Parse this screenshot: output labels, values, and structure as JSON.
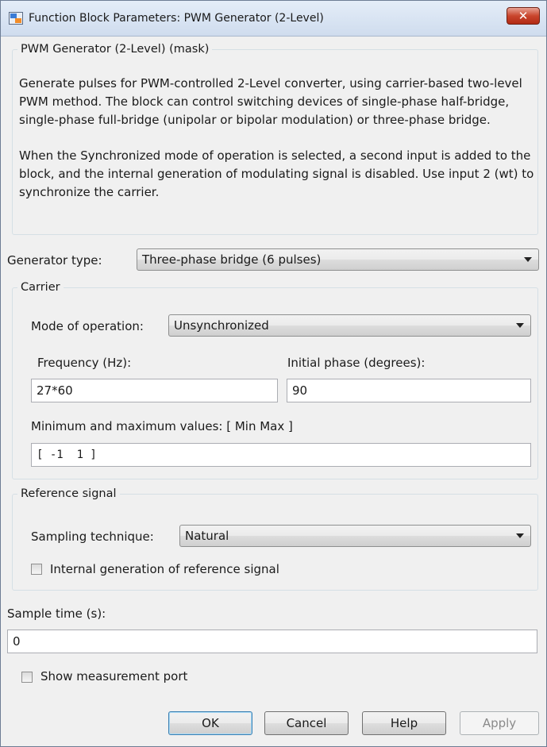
{
  "window": {
    "title": "Function Block Parameters: PWM Generator (2-Level)",
    "close_icon": "close-icon"
  },
  "mask": {
    "group_title": "PWM Generator (2-Level) (mask)",
    "description_p1": "Generate pulses for PWM-controlled 2-Level converter, using carrier-based two-level PWM method. The block can control switching devices of single-phase half-bridge, single-phase full-bridge (unipolar or bipolar modulation) or three-phase bridge.",
    "description_p2": "When the Synchronized mode of operation is selected, a second input is added to the block, and the internal generation of modulating signal is disabled. Use input 2 (wt) to synchronize the carrier."
  },
  "generator": {
    "label": "Generator type:",
    "value": "Three-phase bridge (6 pulses)"
  },
  "carrier": {
    "group_title": "Carrier",
    "mode_label": "Mode of operation:",
    "mode_value": "Unsynchronized",
    "frequency_label": "Frequency (Hz):",
    "frequency_value": "27*60",
    "phase_label": "Initial phase (degrees):",
    "phase_value": "90",
    "minmax_label": "Minimum and maximum values: [ Min  Max ]",
    "minmax_value": "[ -1  1 ]"
  },
  "reference": {
    "group_title": "Reference signal",
    "sampling_label": "Sampling technique:",
    "sampling_value": "Natural",
    "internal_gen_label": "Internal generation of reference signal",
    "internal_gen_checked": false
  },
  "sample_time": {
    "label": "Sample time (s):",
    "value": "0"
  },
  "measurement": {
    "label": "Show measurement port",
    "checked": false
  },
  "buttons": {
    "ok": "OK",
    "cancel": "Cancel",
    "help": "Help",
    "apply": "Apply"
  },
  "colors": {
    "accent": "#3c7fb1",
    "close_red": "#c9452d",
    "dialog_bg": "#f0f0f0"
  }
}
